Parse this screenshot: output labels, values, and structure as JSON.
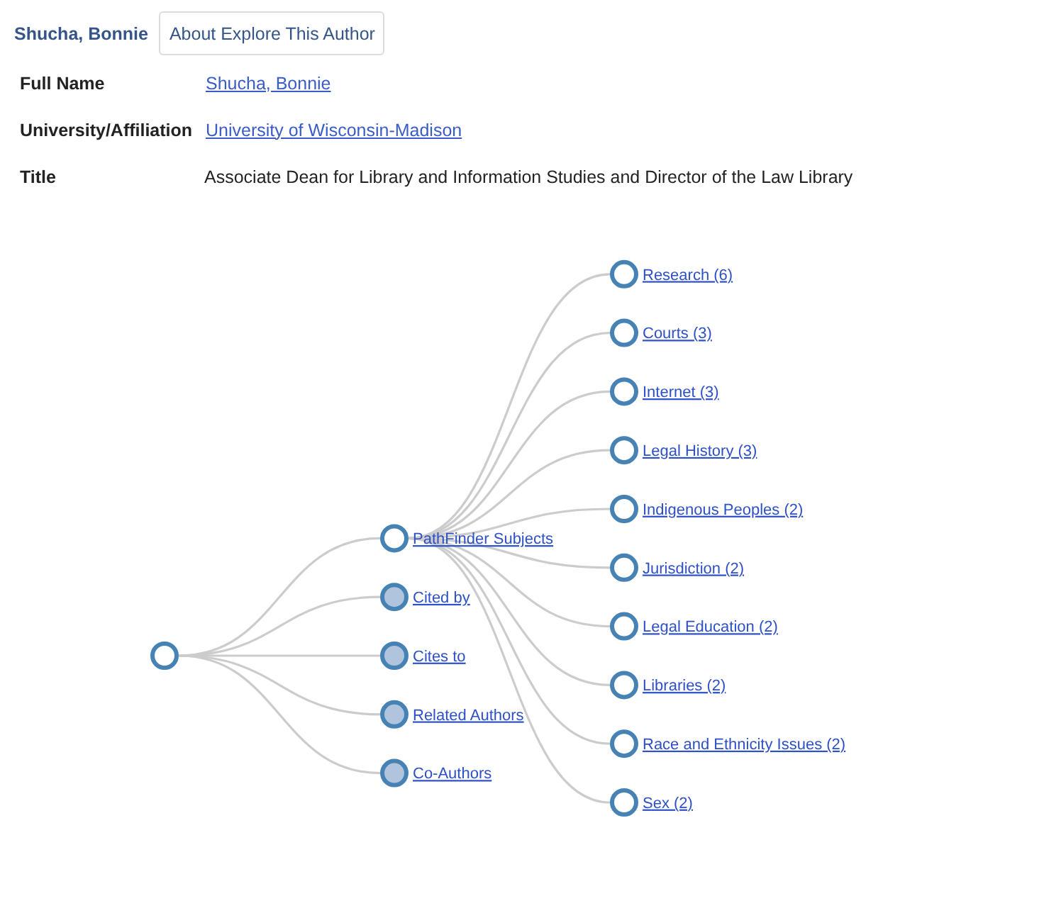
{
  "header": {
    "author_name": "Shucha, Bonnie",
    "about_button": "About Explore This Author"
  },
  "details": [
    {
      "label": "Full Name",
      "value": "Shucha, Bonnie",
      "kind": "link"
    },
    {
      "label": "University/Affiliation",
      "value": "University of Wisconsin-Madison",
      "kind": "link"
    },
    {
      "label": "Title",
      "value": "Associate Dean for Library and Information Studies and Director of the Law Library",
      "kind": "text"
    }
  ],
  "tree": {
    "collapsed": false,
    "children": [
      {
        "label": "PathFinder Subjects",
        "collapsed": false,
        "children": [
          {
            "label": "Research (6)",
            "collapsed": false
          },
          {
            "label": "Courts (3)",
            "collapsed": false
          },
          {
            "label": "Internet (3)",
            "collapsed": false
          },
          {
            "label": "Legal History (3)",
            "collapsed": false
          },
          {
            "label": "Indigenous Peoples (2)",
            "collapsed": false
          },
          {
            "label": "Jurisdiction (2)",
            "collapsed": false
          },
          {
            "label": "Legal Education (2)",
            "collapsed": false
          },
          {
            "label": "Libraries (2)",
            "collapsed": false
          },
          {
            "label": "Race and Ethnicity Issues (2)",
            "collapsed": false
          },
          {
            "label": "Sex (2)",
            "collapsed": false
          }
        ]
      },
      {
        "label": "Cited by",
        "collapsed": true
      },
      {
        "label": "Cites to",
        "collapsed": true
      },
      {
        "label": "Related Authors",
        "collapsed": true
      },
      {
        "label": "Co-Authors",
        "collapsed": true
      }
    ]
  }
}
